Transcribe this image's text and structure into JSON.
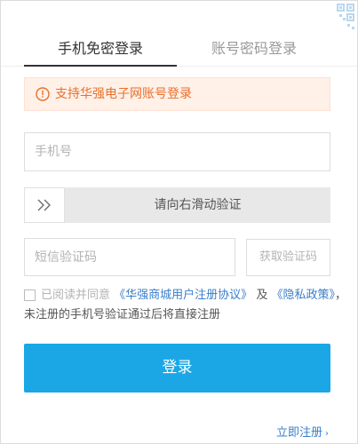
{
  "tabs": [
    {
      "label": "手机免密登录",
      "active": true
    },
    {
      "label": "账号密码登录",
      "active": false
    }
  ],
  "notice": {
    "text": "支持华强电子网账号登录",
    "icon": "alert-circle-icon",
    "color": "#e8702a",
    "background": "#fff0e8"
  },
  "phone_input": {
    "placeholder": "手机号",
    "value": ""
  },
  "slider": {
    "label": "请向右滑动验证",
    "handle_icon": "double-chevron-right-icon"
  },
  "sms": {
    "placeholder": "短信验证码",
    "value": "",
    "button_label": "获取验证码"
  },
  "agreement": {
    "prefix": "已阅读并同意",
    "link1": "《华强商城用户注册协议》",
    "and": "及",
    "link2": "《隐私政策》",
    "comma": "，",
    "line2": "未注册的手机号验证通过后将直接注册",
    "checked": false
  },
  "login_button": {
    "label": "登录",
    "color": "#1ba7e6"
  },
  "register": {
    "label": "立即注册",
    "chevron_icon": "chevron-right-icon"
  },
  "qr_corner": {
    "icon": "qr-code-icon"
  }
}
